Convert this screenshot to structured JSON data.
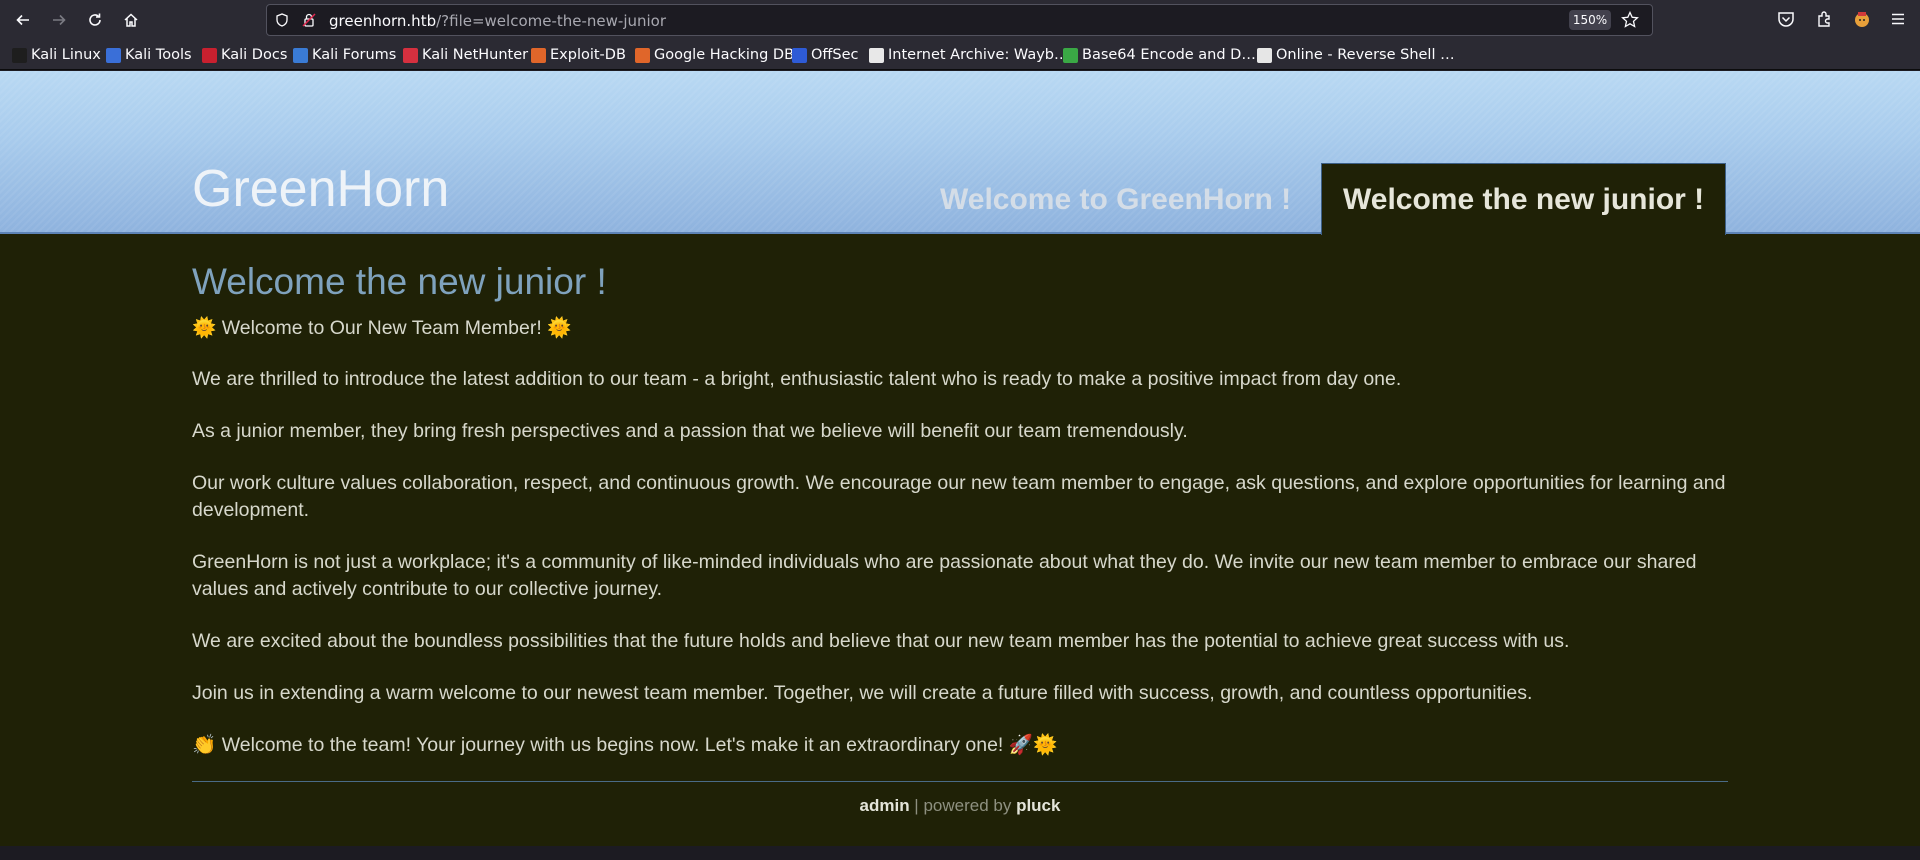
{
  "browser": {
    "url_host": "greenhorn.htb",
    "url_rest": "/?file=welcome-the-new-junior",
    "zoom": "150%",
    "bookmarks": [
      {
        "label": "Kali Linux",
        "color": "#1e1e1e"
      },
      {
        "label": "Kali Tools",
        "color": "#3a6fd8"
      },
      {
        "label": "Kali Docs",
        "color": "#c8202f"
      },
      {
        "label": "Kali Forums",
        "color": "#3a7bd5"
      },
      {
        "label": "Kali NetHunter",
        "color": "#d6303f"
      },
      {
        "label": "Exploit-DB",
        "color": "#e0662a"
      },
      {
        "label": "Google Hacking DB",
        "color": "#e0662a"
      },
      {
        "label": "OffSec",
        "color": "#2e5bd6"
      },
      {
        "label": "Internet Archive: Wayb…",
        "color": "#e8e8e8"
      },
      {
        "label": "Base64 Encode and D…",
        "color": "#3aa845"
      },
      {
        "label": "Online - Reverse Shell …",
        "color": "#e6e6e6"
      }
    ]
  },
  "site": {
    "title": "GreenHorn",
    "nav": [
      "Welcome to GreenHorn !",
      "Welcome the new junior !"
    ]
  },
  "content": {
    "heading": "Welcome the new junior !",
    "paragraphs": [
      "🌞 Welcome to Our New Team Member! 🌞",
      "We are thrilled to introduce the latest addition to our team - a bright, enthusiastic talent who is ready to make a positive impact from day one.",
      "As a junior member, they bring fresh perspectives and a passion that we believe will benefit our team tremendously.",
      "Our work culture values collaboration, respect, and continuous growth. We encourage our new team member to engage, ask questions, and explore opportunities for learning and development.",
      "GreenHorn is not just a workplace; it's a community of like-minded individuals who are passionate about what they do. We invite our new team member to embrace our shared values and actively contribute to our collective journey.",
      "We are excited about the boundless possibilities that the future holds and believe that our new team member has the potential to achieve great success with us.",
      "Join us in extending a warm welcome to our newest team member. Together, we will create a future filled with success, growth, and countless opportunities.",
      "👏 Welcome to the team! Your journey with us begins now. Let's make it an extraordinary one! 🚀🌞"
    ]
  },
  "footer": {
    "admin": "admin",
    "separator": " | powered by ",
    "pluck": "pluck"
  }
}
